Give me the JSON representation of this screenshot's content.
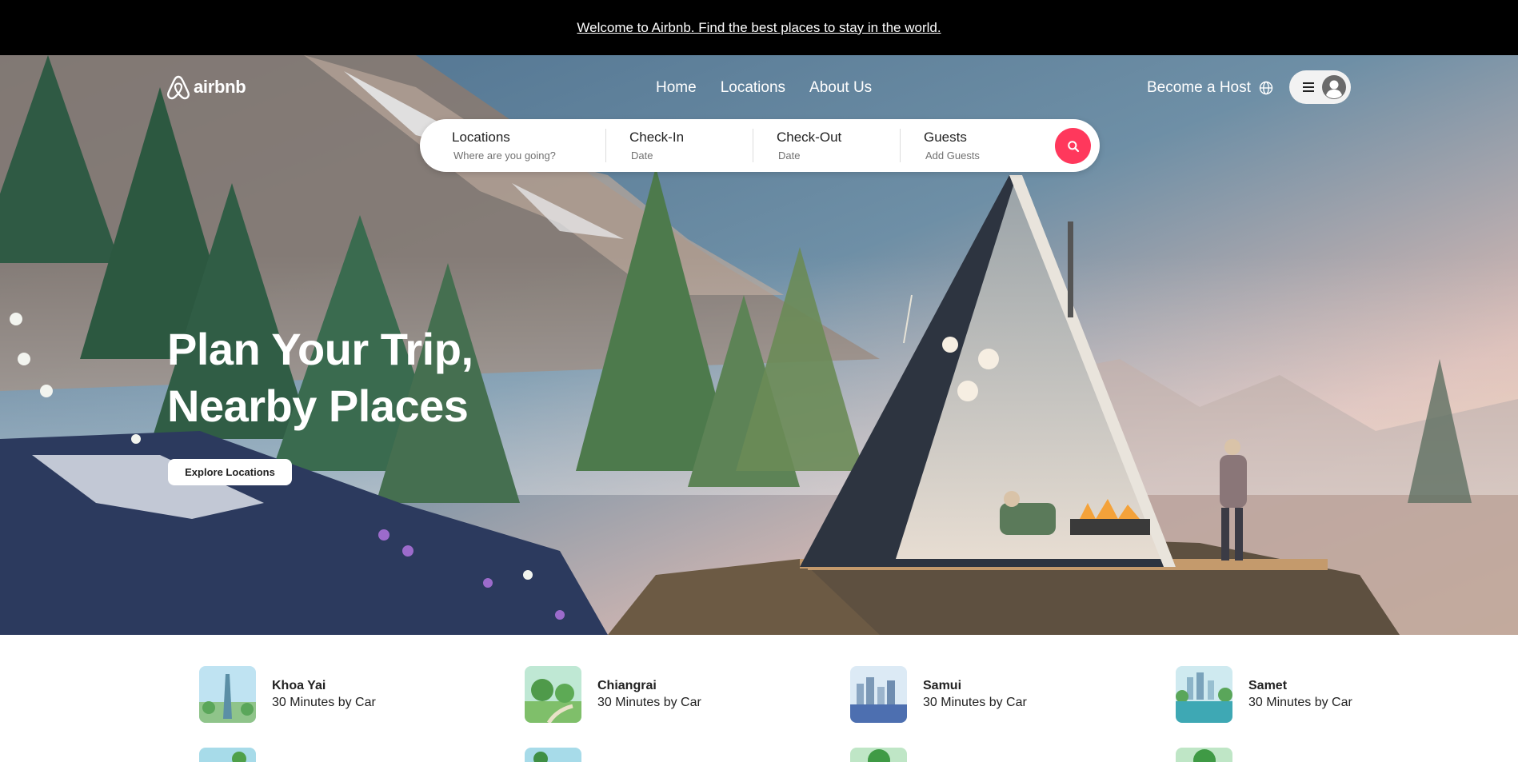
{
  "announcement": {
    "text": "Welcome to Airbnb. Find the best places to stay in the world."
  },
  "header": {
    "logo_text": "airbnb",
    "nav": [
      {
        "label": "Home"
      },
      {
        "label": "Locations"
      },
      {
        "label": "About Us"
      }
    ],
    "become_host": "Become a Host"
  },
  "search": {
    "location": {
      "label": "Locations",
      "placeholder": "Where are you going?"
    },
    "checkin": {
      "label": "Check-In",
      "placeholder": "Date"
    },
    "checkout": {
      "label": "Check-Out",
      "placeholder": "Date"
    },
    "guests": {
      "label": "Guests",
      "placeholder": "Add Guests"
    }
  },
  "hero": {
    "title_line1": "Plan Your Trip,",
    "title_line2": "Nearby Places",
    "cta": "Explore Locations"
  },
  "locations": [
    {
      "name": "Khoa Yai",
      "time": "30 Minutes by Car"
    },
    {
      "name": "Chiangrai",
      "time": "30 Minutes by Car"
    },
    {
      "name": "Samui",
      "time": "30 Minutes by Car"
    },
    {
      "name": "Samet",
      "time": "30 Minutes by Car"
    }
  ],
  "colors": {
    "accent": "#ff385c",
    "announcement_bg": "#000000",
    "text": "#222222",
    "muted": "#717171"
  }
}
